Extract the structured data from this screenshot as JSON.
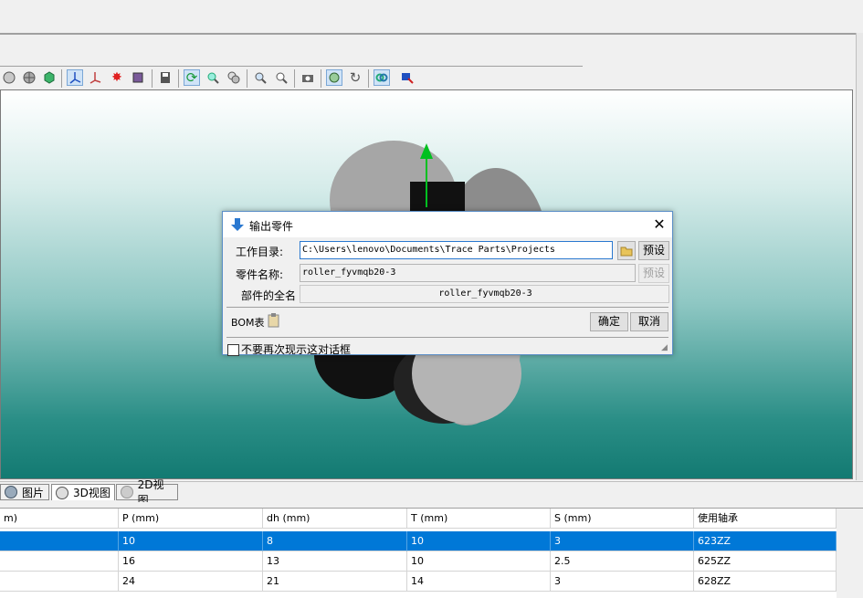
{
  "toolbar": {
    "buttons": [
      "sphere-icon",
      "globe-icon",
      "cube-icon",
      "axis-icon",
      "axis-pointer-icon",
      "star-icon",
      "box-icon",
      "save-icon",
      "rotate-icon",
      "zoom-tool-icon",
      "pan-icon",
      "zoom-window-icon",
      "zoom-fit-icon",
      "camera-icon",
      "view-settings-icon",
      "refresh-icon",
      "link-icon",
      "export-icon"
    ]
  },
  "tabs": {
    "images": "图片",
    "view3d": "3D视图",
    "view2d": "2D视图"
  },
  "table": {
    "headers": [
      "m)",
      "P (mm)",
      "dh (mm)",
      "T (mm)",
      "S (mm)",
      "使用轴承"
    ],
    "rows": [
      [
        "",
        "10",
        "8",
        "10",
        "3",
        "623ZZ"
      ],
      [
        "",
        "16",
        "13",
        "10",
        "2.5",
        "625ZZ"
      ],
      [
        "",
        "24",
        "21",
        "14",
        "3",
        "628ZZ"
      ]
    ]
  },
  "dialog": {
    "title": "输出零件",
    "work_dir_label": "工作目录:",
    "work_dir_value": "C:\\Users\\lenovo\\Documents\\Trace Parts\\Projects",
    "preset_label": "预设",
    "part_name_label": "零件名称:",
    "part_name_value": "roller_fyvmqb20-3",
    "preset_label_disabled": "预设",
    "full_name_label": "部件的全名",
    "full_name_value": "roller_fyvmqb20-3",
    "bom_label": "BOM表",
    "ok_label": "确定",
    "cancel_label": "取消",
    "dont_show_label": "不要再次现示这对话框"
  },
  "colors": {
    "selection": "#0078d7",
    "viewport_top": "#ffffff",
    "viewport_bottom": "#137a72",
    "axis_green": "#00c020"
  }
}
